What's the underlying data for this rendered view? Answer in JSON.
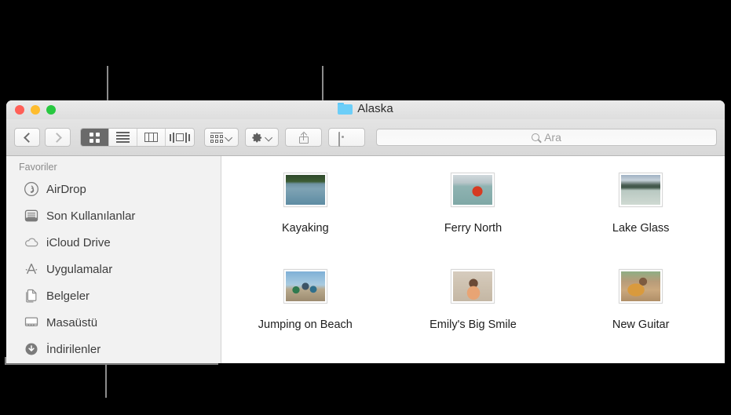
{
  "window": {
    "title": "Alaska",
    "title_icon": "blue-folder-icon",
    "traffic_lights": [
      {
        "name": "close-button",
        "color": "#ff5f57"
      },
      {
        "name": "minimize-button",
        "color": "#febc2e"
      },
      {
        "name": "zoom-button",
        "color": "#28c840"
      }
    ]
  },
  "toolbar": {
    "back_label": "",
    "forward_label": "",
    "view_modes": [
      {
        "name": "icon-view",
        "icon": "grid-icon",
        "selected": true
      },
      {
        "name": "list-view",
        "icon": "list-icon",
        "selected": false
      },
      {
        "name": "column-view",
        "icon": "columns-icon",
        "selected": false
      },
      {
        "name": "gallery-view",
        "icon": "coverflow-icon",
        "selected": false
      }
    ],
    "arrange_label": "",
    "action_label": "",
    "share_label": "",
    "tags_label": ""
  },
  "search": {
    "placeholder": "Ara",
    "value": "",
    "icon": "search-icon"
  },
  "sidebar": {
    "header": "Favoriler",
    "items": [
      {
        "label": "AirDrop",
        "icon": "airdrop-icon"
      },
      {
        "label": "Son Kullanılanlar",
        "icon": "recents-icon"
      },
      {
        "label": "iCloud Drive",
        "icon": "cloud-icon"
      },
      {
        "label": "Uygulamalar",
        "icon": "applications-icon"
      },
      {
        "label": "Belgeler",
        "icon": "documents-icon"
      },
      {
        "label": "Masaüstü",
        "icon": "desktop-icon"
      },
      {
        "label": "İndirilenler",
        "icon": "downloads-icon"
      }
    ]
  },
  "files": [
    {
      "name": "Kayaking",
      "thumb": "kayaking-thumbnail"
    },
    {
      "name": "Ferry North",
      "thumb": "ferry-north-thumbnail"
    },
    {
      "name": "Lake Glass",
      "thumb": "lake-glass-thumbnail"
    },
    {
      "name": "Jumping on Beach",
      "thumb": "jumping-on-beach-thumbnail"
    },
    {
      "name": "Emily's Big Smile",
      "thumb": "emilys-big-smile-thumbnail"
    },
    {
      "name": "New Guitar",
      "thumb": "new-guitar-thumbnail"
    }
  ],
  "colors": {
    "title_folder": "#6ccef8",
    "selected_segment": "#6a6a6a",
    "sidebar_bg": "#f2f2f2",
    "callout_line": "#8c8c8c"
  }
}
